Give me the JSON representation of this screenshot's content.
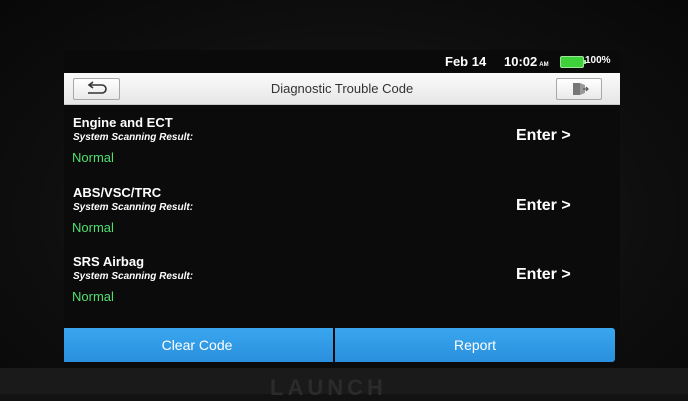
{
  "status": {
    "date": "Feb 14",
    "time": "10:02",
    "ampm": "AM",
    "battery": "100%"
  },
  "header": {
    "title": "Diagnostic Trouble Code"
  },
  "systems": [
    {
      "name": "Engine and ECT",
      "label": "System Scanning Result:",
      "status": "Normal",
      "action": "Enter >"
    },
    {
      "name": "ABS/VSC/TRC",
      "label": "System Scanning Result:",
      "status": "Normal",
      "action": "Enter >"
    },
    {
      "name": "SRS Airbag",
      "label": "System Scanning Result:",
      "status": "Normal",
      "action": "Enter >"
    }
  ],
  "buttons": {
    "clear": "Clear Code",
    "report": "Report"
  },
  "device": {
    "brand": "LAUNCH"
  },
  "colors": {
    "accent": "#2a8fdd",
    "status_ok": "#4fe070",
    "battery": "#3fd13a"
  },
  "icons": {
    "back": "back-arrow-icon",
    "exit": "exit-icon"
  }
}
